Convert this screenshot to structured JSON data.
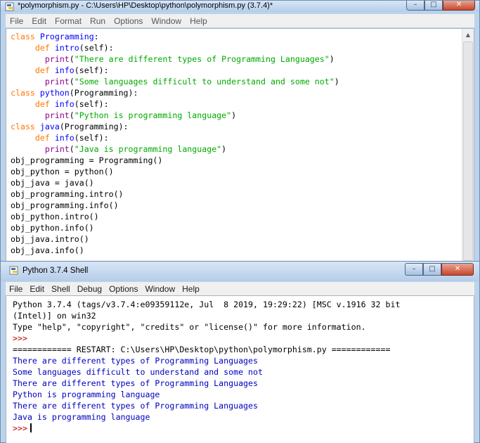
{
  "editor": {
    "title": "*polymorphism.py - C:\\Users\\HP\\Desktop\\python\\polymorphism.py (3.7.4)*",
    "menu": [
      "File",
      "Edit",
      "Format",
      "Run",
      "Options",
      "Window",
      "Help"
    ],
    "code_lines": [
      [
        {
          "t": "class ",
          "c": "kw"
        },
        {
          "t": "Programming",
          "c": "def"
        },
        {
          "t": ":",
          "c": "pl"
        }
      ],
      [
        {
          "t": "     ",
          "c": "pl"
        },
        {
          "t": "def ",
          "c": "kw"
        },
        {
          "t": "intro",
          "c": "def"
        },
        {
          "t": "(self):",
          "c": "pl"
        }
      ],
      [
        {
          "t": "       ",
          "c": "pl"
        },
        {
          "t": "print",
          "c": "bi"
        },
        {
          "t": "(",
          "c": "pl"
        },
        {
          "t": "\"There are different types of Programming Languages\"",
          "c": "str"
        },
        {
          "t": ")",
          "c": "pl"
        }
      ],
      [
        {
          "t": "     ",
          "c": "pl"
        },
        {
          "t": "def ",
          "c": "kw"
        },
        {
          "t": "info",
          "c": "def"
        },
        {
          "t": "(self):",
          "c": "pl"
        }
      ],
      [
        {
          "t": "       ",
          "c": "pl"
        },
        {
          "t": "print",
          "c": "bi"
        },
        {
          "t": "(",
          "c": "pl"
        },
        {
          "t": "\"Some languages difficult to understand and some not\"",
          "c": "str"
        },
        {
          "t": ")",
          "c": "pl"
        }
      ],
      [
        {
          "t": "class ",
          "c": "kw"
        },
        {
          "t": "python",
          "c": "def"
        },
        {
          "t": "(Programming):",
          "c": "pl"
        }
      ],
      [
        {
          "t": "     ",
          "c": "pl"
        },
        {
          "t": "def ",
          "c": "kw"
        },
        {
          "t": "info",
          "c": "def"
        },
        {
          "t": "(self):",
          "c": "pl"
        }
      ],
      [
        {
          "t": "       ",
          "c": "pl"
        },
        {
          "t": "print",
          "c": "bi"
        },
        {
          "t": "(",
          "c": "pl"
        },
        {
          "t": "\"Python is programming language\"",
          "c": "str"
        },
        {
          "t": ")",
          "c": "pl"
        }
      ],
      [
        {
          "t": "class ",
          "c": "kw"
        },
        {
          "t": "java",
          "c": "def"
        },
        {
          "t": "(Programming):",
          "c": "pl"
        }
      ],
      [
        {
          "t": "     ",
          "c": "pl"
        },
        {
          "t": "def ",
          "c": "kw"
        },
        {
          "t": "info",
          "c": "def"
        },
        {
          "t": "(self):",
          "c": "pl"
        }
      ],
      [
        {
          "t": "       ",
          "c": "pl"
        },
        {
          "t": "print",
          "c": "bi"
        },
        {
          "t": "(",
          "c": "pl"
        },
        {
          "t": "\"Java is programming language\"",
          "c": "str"
        },
        {
          "t": ")",
          "c": "pl"
        }
      ],
      [
        {
          "t": "obj_programming = Programming()",
          "c": "pl"
        }
      ],
      [
        {
          "t": "obj_python = python()",
          "c": "pl"
        }
      ],
      [
        {
          "t": "obj_java = java()",
          "c": "pl"
        }
      ],
      [
        {
          "t": "obj_programming.intro()",
          "c": "pl"
        }
      ],
      [
        {
          "t": "obj_programming.info()",
          "c": "pl"
        }
      ],
      [
        {
          "t": "obj_python.intro()",
          "c": "pl"
        }
      ],
      [
        {
          "t": "obj_python.info()",
          "c": "pl"
        }
      ],
      [
        {
          "t": "obj_java.intro()",
          "c": "pl"
        }
      ],
      [
        {
          "t": "obj_java.info()",
          "c": "pl"
        }
      ]
    ]
  },
  "shell": {
    "title": "Python 3.7.4 Shell",
    "menu": [
      "File",
      "Edit",
      "Shell",
      "Debug",
      "Options",
      "Window",
      "Help"
    ],
    "lines": [
      [
        {
          "t": "Python 3.7.4 (tags/v3.7.4:e09359112e, Jul  8 2019, 19:29:22) [MSC v.1916 32 bit",
          "c": "pl"
        }
      ],
      [
        {
          "t": "(Intel)] on win32",
          "c": "pl"
        }
      ],
      [
        {
          "t": "Type \"help\", \"copyright\", \"credits\" or \"license()\" for more information.",
          "c": "pl"
        }
      ],
      [
        {
          "t": ">>>",
          "c": "prompt"
        }
      ],
      [
        {
          "t": "============ RESTART: C:\\Users\\HP\\Desktop\\python\\polymorphism.py ============",
          "c": "pl"
        }
      ],
      [
        {
          "t": "There are different types of Programming Languages",
          "c": "out"
        }
      ],
      [
        {
          "t": "Some languages difficult to understand and some not",
          "c": "out"
        }
      ],
      [
        {
          "t": "There are different types of Programming Languages",
          "c": "out"
        }
      ],
      [
        {
          "t": "Python is programming language",
          "c": "out"
        }
      ],
      [
        {
          "t": "There are different types of Programming Languages",
          "c": "out"
        }
      ],
      [
        {
          "t": "Java is programming language",
          "c": "out"
        }
      ]
    ],
    "prompt": ">>>"
  },
  "window_controls": {
    "minimize": "–",
    "maximize": "□",
    "close": "✕"
  },
  "colors": {
    "keyword": "#ff7700",
    "definition": "#0000ff",
    "builtin": "#900090",
    "string": "#00aa00",
    "output": "#0000c0",
    "prompt": "#c00000"
  },
  "icons": {
    "app": "python-idle-icon"
  }
}
